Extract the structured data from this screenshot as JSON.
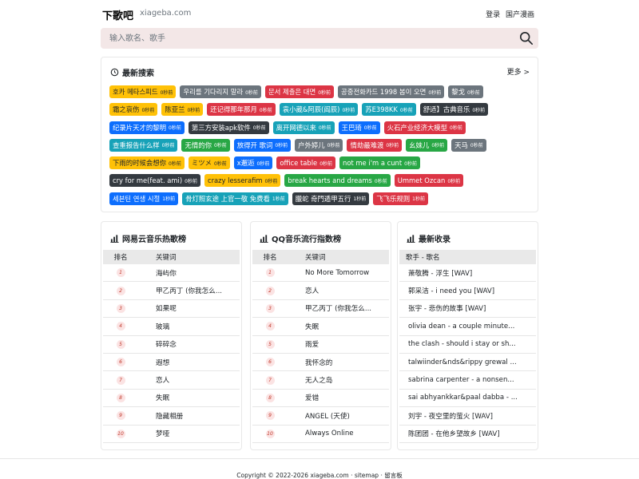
{
  "header": {
    "brand": "下歌吧",
    "domain": "xiageba.com",
    "nav": [
      "登录",
      "国产漫画"
    ]
  },
  "search": {
    "placeholder": "输入歌名、歌手"
  },
  "latest": {
    "title": "最新搜索",
    "more": "更多 >",
    "rows": [
      [
        {
          "t": "호카 메타스피드",
          "a": "0秒前",
          "c": "#ffc107"
        },
        {
          "t": "우리를 기다리지 말라",
          "a": "0秒前",
          "c": "#6c757d"
        },
        {
          "t": "문서 제출은 대면",
          "a": "0秒前",
          "c": "#dc3545"
        },
        {
          "t": "공중전화카드 1998 봄이 오면",
          "a": "0秒前",
          "c": "#6c757d"
        },
        {
          "t": "黎戈",
          "a": "0秒前",
          "c": "#6c757d"
        }
      ],
      [
        {
          "t": "霜之哀伤",
          "a": "0秒前",
          "c": "#ffc107"
        },
        {
          "t": "陈亚兰",
          "a": "0秒前",
          "c": "#ffc107"
        },
        {
          "t": "还记得那年那月",
          "a": "0秒前",
          "c": "#dc3545"
        },
        {
          "t": "袁小葳&阿辰(阎辰)",
          "a": "0秒前",
          "c": "#17a2b8"
        },
        {
          "t": "苏E398KK",
          "a": "0秒前",
          "c": "#17a2b8"
        },
        {
          "t": "舒适】古典音乐",
          "a": "0秒前",
          "c": "#343a40"
        }
      ],
      [
        {
          "t": "纪录片天才的黎明",
          "a": "0秒前",
          "c": "#0d6efd"
        },
        {
          "t": "第三方安装apk软件",
          "a": "0秒前",
          "c": "#343a40"
        },
        {
          "t": "离开网德以来",
          "a": "0秒前",
          "c": "#17a2b8"
        },
        {
          "t": "王巴琦",
          "a": "0秒前",
          "c": "#0d6efd"
        },
        {
          "t": "火石产业经济大模型",
          "a": "0秒前",
          "c": "#dc3545"
        }
      ],
      [
        {
          "t": "查重报告什么样",
          "a": "0秒前",
          "c": "#17a2b8"
        },
        {
          "t": "无情的你",
          "a": "0秒前",
          "c": "#28a745"
        },
        {
          "t": "放得开 歌词",
          "a": "0秒前",
          "c": "#0d6efd"
        },
        {
          "t": "户外婷儿",
          "a": "0秒前",
          "c": "#6c757d"
        },
        {
          "t": "情劫最难渡",
          "a": "0秒前",
          "c": "#dc3545"
        },
        {
          "t": "幺妹儿",
          "a": "0秒前",
          "c": "#28a745"
        },
        {
          "t": "天马",
          "a": "0秒前",
          "c": "#6c757d"
        }
      ],
      [
        {
          "t": "下雨的时候会想你",
          "a": "0秒前",
          "c": "#ffc107"
        },
        {
          "t": "ミツメ",
          "a": "0秒前",
          "c": "#ffc107"
        },
        {
          "t": "x邂逅",
          "a": "0秒前",
          "c": "#0d6efd"
        },
        {
          "t": "office table",
          "a": "0秒前",
          "c": "#dc3545"
        },
        {
          "t": "not me i'm a cunt",
          "a": "0秒前",
          "c": "#28a745"
        }
      ],
      [
        {
          "t": "cry for me(feat. ami)",
          "a": "0秒前",
          "c": "#343a40"
        },
        {
          "t": "crazy lesserafim",
          "a": "0秒前",
          "c": "#ffc107"
        },
        {
          "t": "break hearts and dreams",
          "a": "0秒前",
          "c": "#28a745"
        },
        {
          "t": "Ummet Ozcan",
          "a": "0秒前",
          "c": "#dc3545"
        }
      ],
      [
        {
          "t": "세븐틴 연생 시절",
          "a": "1秒前",
          "c": "#0d6efd"
        },
        {
          "t": "骨灯照玄途 上官一敬 免费看",
          "a": "1秒前",
          "c": "#17a2b8"
        },
        {
          "t": "臘蛇 奇門遁甲五行",
          "a": "1秒前",
          "c": "#343a40"
        },
        {
          "t": "飞飞乐规则",
          "a": "1秒前",
          "c": "#dc3545"
        }
      ]
    ]
  },
  "netease": {
    "title": "网易云音乐热歌榜",
    "col_rank": "排名",
    "col_kw": "关键词",
    "items": [
      {
        "rank": "1",
        "kw": "海屿你"
      },
      {
        "rank": "2",
        "kw": "甲乙丙丁 (你我怎么..."
      },
      {
        "rank": "3",
        "kw": "如果呢"
      },
      {
        "rank": "4",
        "kw": "玻璃"
      },
      {
        "rank": "5",
        "kw": "碎碎念"
      },
      {
        "rank": "6",
        "kw": "遐想"
      },
      {
        "rank": "7",
        "kw": "恋人"
      },
      {
        "rank": "8",
        "kw": "失眠"
      },
      {
        "rank": "9",
        "kw": "隐藏相册"
      },
      {
        "rank": "10",
        "kw": "梦哑"
      }
    ]
  },
  "qq": {
    "title": "QQ音乐流行指数榜",
    "col_rank": "排名",
    "col_kw": "关键词",
    "items": [
      {
        "rank": "1",
        "kw": "No More Tomorrow"
      },
      {
        "rank": "2",
        "kw": "恋人"
      },
      {
        "rank": "3",
        "kw": "甲乙丙丁 (你我怎么..."
      },
      {
        "rank": "4",
        "kw": "失眠"
      },
      {
        "rank": "5",
        "kw": "雨爱"
      },
      {
        "rank": "6",
        "kw": "我怀念的"
      },
      {
        "rank": "7",
        "kw": "无人之岛"
      },
      {
        "rank": "8",
        "kw": "爱错"
      },
      {
        "rank": "9",
        "kw": "ANGEL (天使)"
      },
      {
        "rank": "10",
        "kw": "Always Online"
      }
    ]
  },
  "recent": {
    "title": "最新收录",
    "col": "歌手 - 歌名",
    "items": [
      "萧敬腾 - 浮生 [WAV]",
      "郭采洁 - i need you [WAV]",
      "张宇 - 悲伤的故事 [WAV]",
      "olivia dean - a couple minute...",
      "the clash - should i stay or sh...",
      "talwiinder&nds&rippy grewal ...",
      "sabrina carpenter - a nonsen...",
      "sai abhyankkar&paal dabba - ...",
      "刘宇 - 夜空里的萤火 [WAV]",
      "陈团团 - 在他乡望故乡 [WAV]"
    ]
  },
  "footer": {
    "copyright": "Copyright © 2022-2026 xiageba.com",
    "sep": " · ",
    "sitemap": "sitemap",
    "guestbook": "留言板"
  }
}
